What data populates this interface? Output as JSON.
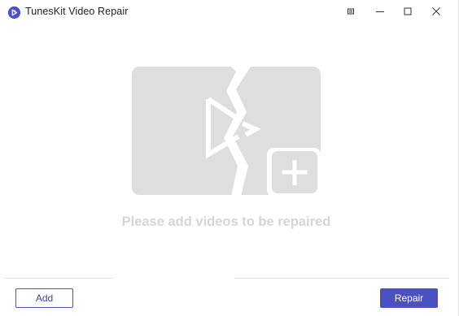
{
  "app": {
    "title": "TunesKit Video Repair",
    "logo_icon": "tuneskit-logo-icon",
    "accent_color": "#4c51c2"
  },
  "titlebar": {
    "buttons": [
      {
        "name": "menu-icon"
      },
      {
        "name": "minimize-icon"
      },
      {
        "name": "maximize-icon"
      },
      {
        "name": "close-icon"
      }
    ]
  },
  "main": {
    "placeholder_icon": "broken-video-add-icon",
    "empty_message": "Please add videos to be repaired"
  },
  "footer": {
    "add_label": "Add",
    "repair_label": "Repair"
  }
}
